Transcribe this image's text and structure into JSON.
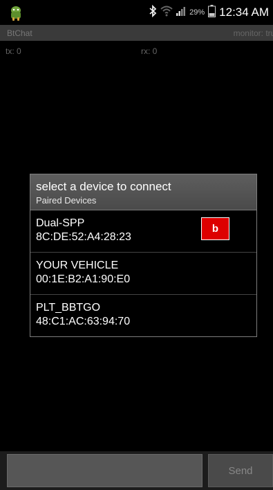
{
  "status_bar": {
    "app_icon": "android-robot-icon",
    "icons": [
      "bluetooth-icon",
      "wifi-icon",
      "signal-icon",
      "battery-icon"
    ],
    "battery_percent": "29%",
    "time": "12:34 AM"
  },
  "title_bar": {
    "app_title": "BtChat",
    "monitor_status": "monitor: true"
  },
  "counters": {
    "tx": "tx: 0",
    "rx": "rx: 0"
  },
  "dialog": {
    "title": "select a device to connect",
    "subtitle": "Paired Devices",
    "devices": [
      {
        "name": "Dual-SPP",
        "mac": "8C:DE:52:A4:28:23"
      },
      {
        "name": "YOUR VEHICLE",
        "mac": "00:1E:B2:A1:90:E0"
      },
      {
        "name": "PLT_BBTGO",
        "mac": "48:C1:AC:63:94:70"
      }
    ],
    "marker_label": "b"
  },
  "bottom_bar": {
    "input_value": "",
    "send_label": "Send"
  },
  "colors": {
    "background": "#000000",
    "title_bar": "#3a3a3a",
    "dialog_header": "#555555",
    "marker": "#dd0000",
    "bottom_bar": "#1c1c1c"
  }
}
